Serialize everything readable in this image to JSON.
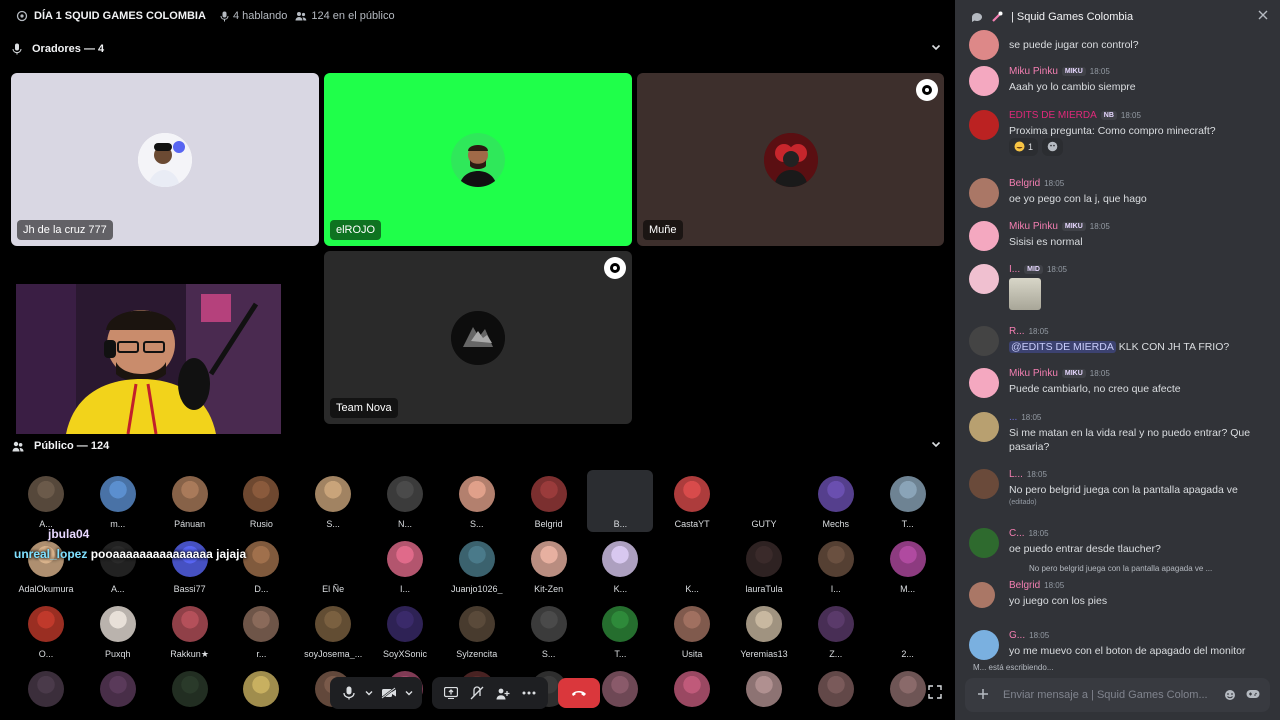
{
  "topbar": {
    "title": "DÍA 1 SQUID GAMES COLOMBIA",
    "speaking": "4 hablando",
    "audience": "124 en el público"
  },
  "speakers": {
    "heading": "Oradores — 4"
  },
  "tiles": [
    {
      "name": "Jh de la cruz 777",
      "bg": "#d9d7e3"
    },
    {
      "name": "elROJO",
      "bg": "#1fff4a"
    },
    {
      "name": "Muñe",
      "bg": "#3d2f2c"
    },
    {
      "name": "Team Nova",
      "bg": "#2a2a2a"
    }
  ],
  "public": {
    "heading": "Público — 124"
  },
  "overlay": {
    "line1": "jbula04",
    "user": "unreal_lopez",
    "line2": "pooaaaaaaaaaaaaaaa jajaja"
  },
  "audience": [
    [
      "A...",
      "m...",
      "Pánuan",
      "Rusio",
      "S...",
      "N...",
      "S...",
      "Belgrid",
      "B...",
      "CastaYT",
      "GUTY",
      "Mechs",
      "T..."
    ],
    [
      "AdalOkumura",
      "A...",
      "Bassi77",
      "D...",
      "El Ñe",
      "I...",
      "Juanjo1026_",
      "Kit-Zen",
      "K...",
      "K...",
      "lauraTula",
      "I...",
      "M..."
    ],
    [
      "O...",
      "Puxqh",
      "Rakkun★",
      "r...",
      "soyJosema_...",
      "SoyXSonic",
      "Sylzencita",
      "S...",
      "T...",
      "Usita",
      "Yeremias13",
      "Z...",
      "2..."
    ],
    [
      "",
      "",
      "",
      "",
      "",
      "",
      "",
      "",
      "",
      "",
      "",
      "",
      ""
    ]
  ],
  "chat": {
    "title": "| Squid Games Colombia",
    "messages": [
      {
        "author": "",
        "time": "",
        "text": "se puede jugar con control?"
      },
      {
        "author": "Miku Pinku",
        "tag": "MIKU",
        "time": "18:05",
        "text": "Aaah yo lo cambio siempre"
      },
      {
        "author": "EDITS DE MIERDA",
        "tag": "NB",
        "time": "18:05",
        "text": "Proxima pregunta: Como compro minecraft?",
        "reaction_count": "1"
      },
      {
        "author": "Belgrid",
        "time": "18:05",
        "text": "oe yo pego con la j, que hago"
      },
      {
        "author": "Miku Pinku",
        "tag": "MIKU",
        "time": "18:05",
        "text": "Sisisi es normal"
      },
      {
        "author": "I...",
        "tag": "MID",
        "time": "18:05",
        "text": ""
      },
      {
        "author": "R...",
        "time": "18:05",
        "mention": "@EDITS DE MIERDA",
        "text": "KLK CON JH TA FRIO?"
      },
      {
        "author": "Miku Pinku",
        "tag": "MIKU",
        "time": "18:05",
        "text": "Puede cambiarlo, no creo que afecte"
      },
      {
        "author": "...",
        "time": "18:05",
        "text": "Si me matan en la vida real y no puedo entrar? Que pasaria?"
      },
      {
        "author": "L...",
        "time": "18:05",
        "text": "No pero belgrid juega con la pantalla apagada ve",
        "edited": "(editado)"
      },
      {
        "author": "C...",
        "time": "18:05",
        "text": "oe puedo entrar desde tlaucher?"
      },
      {
        "author": "Belgrid",
        "time": "18:05",
        "reply": "No pero belgrid juega con la pantalla apagada ve ...",
        "text": "yo juego con los pies"
      },
      {
        "author": "G...",
        "time": "18:05",
        "text": "yo me muevo con el boton de apagado del monitor"
      }
    ],
    "typing": "M... está escribiendo...",
    "composer_placeholder": "Enviar mensaje a  | Squid Games Colom..."
  },
  "colors": {
    "pink": "#f47fb2",
    "brand_red": "#da373c",
    "panel": "#313338"
  }
}
